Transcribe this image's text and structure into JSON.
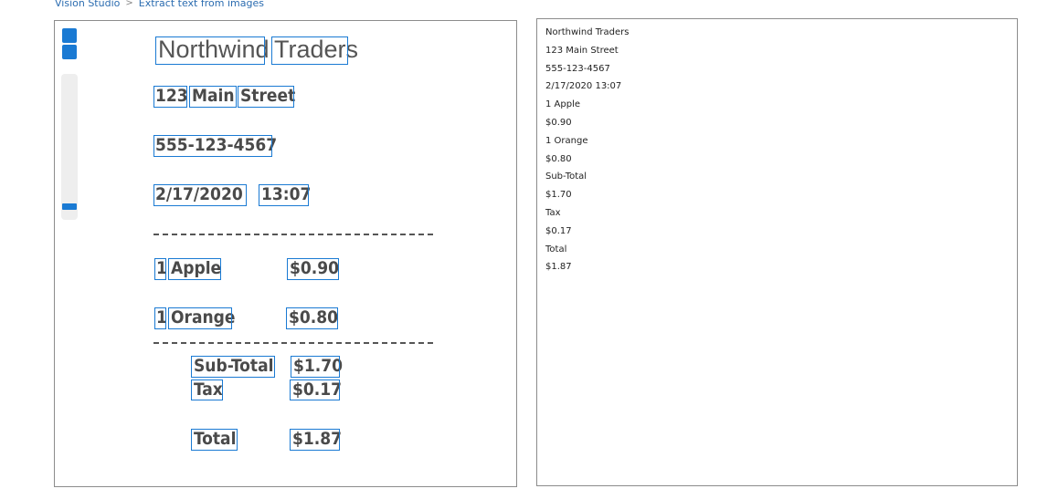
{
  "breadcrumb": [
    "Vision Studio",
    "Extract text from images"
  ],
  "receipt": {
    "title": [
      "Northwind",
      "Traders"
    ],
    "address": [
      "123",
      "Main",
      "Street"
    ],
    "phone": "555-123-4567",
    "date": "2/17/2020",
    "time": "13:07",
    "separator": "-----------------------------",
    "items": [
      {
        "qty": "1",
        "name": "Apple",
        "price": "$0.90"
      },
      {
        "qty": "1",
        "name": "Orange",
        "price": "$0.80"
      }
    ],
    "subtotal_label": "Sub-Total",
    "subtotal_value": "$1.70",
    "tax_label": "Tax",
    "tax_value": "$0.17",
    "total_label": "Total",
    "total_value": "$1.87"
  },
  "extracted_lines": [
    "Northwind Traders",
    "123 Main Street",
    "555-123-4567",
    "2/17/2020 13:07",
    "1 Apple",
    "$0.90",
    "1 Orange",
    "$0.80",
    "Sub-Total",
    "$1.70",
    "Tax",
    "$0.17",
    "Total",
    "$1.87"
  ],
  "colors": {
    "accent": "#1a7ad3",
    "border": "#8c8c8c",
    "text": "#4a4a4a"
  }
}
